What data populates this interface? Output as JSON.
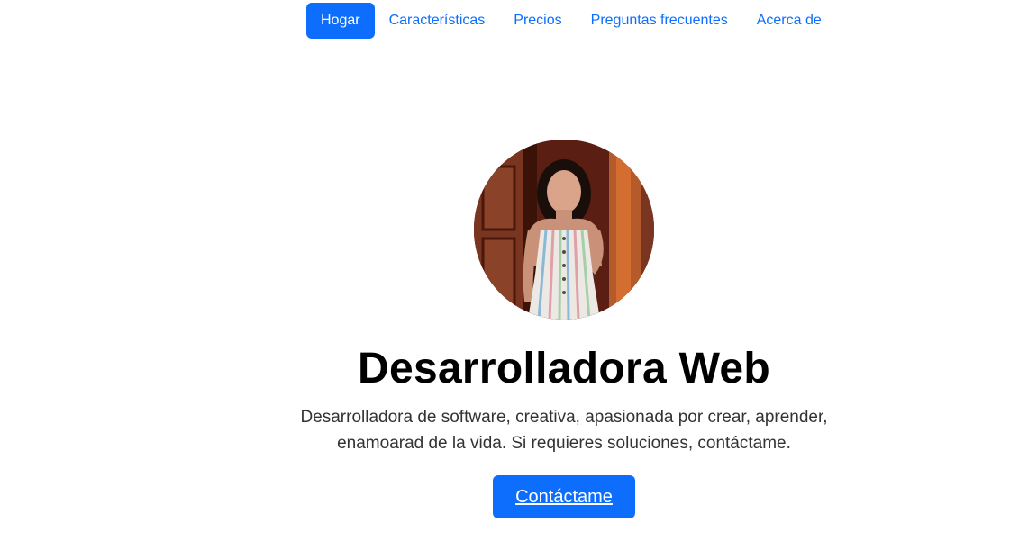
{
  "nav": {
    "items": [
      {
        "label": "Hogar",
        "active": true
      },
      {
        "label": "Características"
      },
      {
        "label": "Precios"
      },
      {
        "label": "Preguntas frecuentes"
      },
      {
        "label": "Acerca de"
      }
    ]
  },
  "hero": {
    "avatar_icon": "profile-photo",
    "title": "Desarrolladora Web",
    "description_line1": "Desarrolladora de software, creativa, apasionada por crear, aprender,",
    "description_line2": "enamoarad de la vida. Si requieres soluciones, contáctame.",
    "cta_label": "Contáctame"
  },
  "colors": {
    "primary": "#0d6efd"
  }
}
